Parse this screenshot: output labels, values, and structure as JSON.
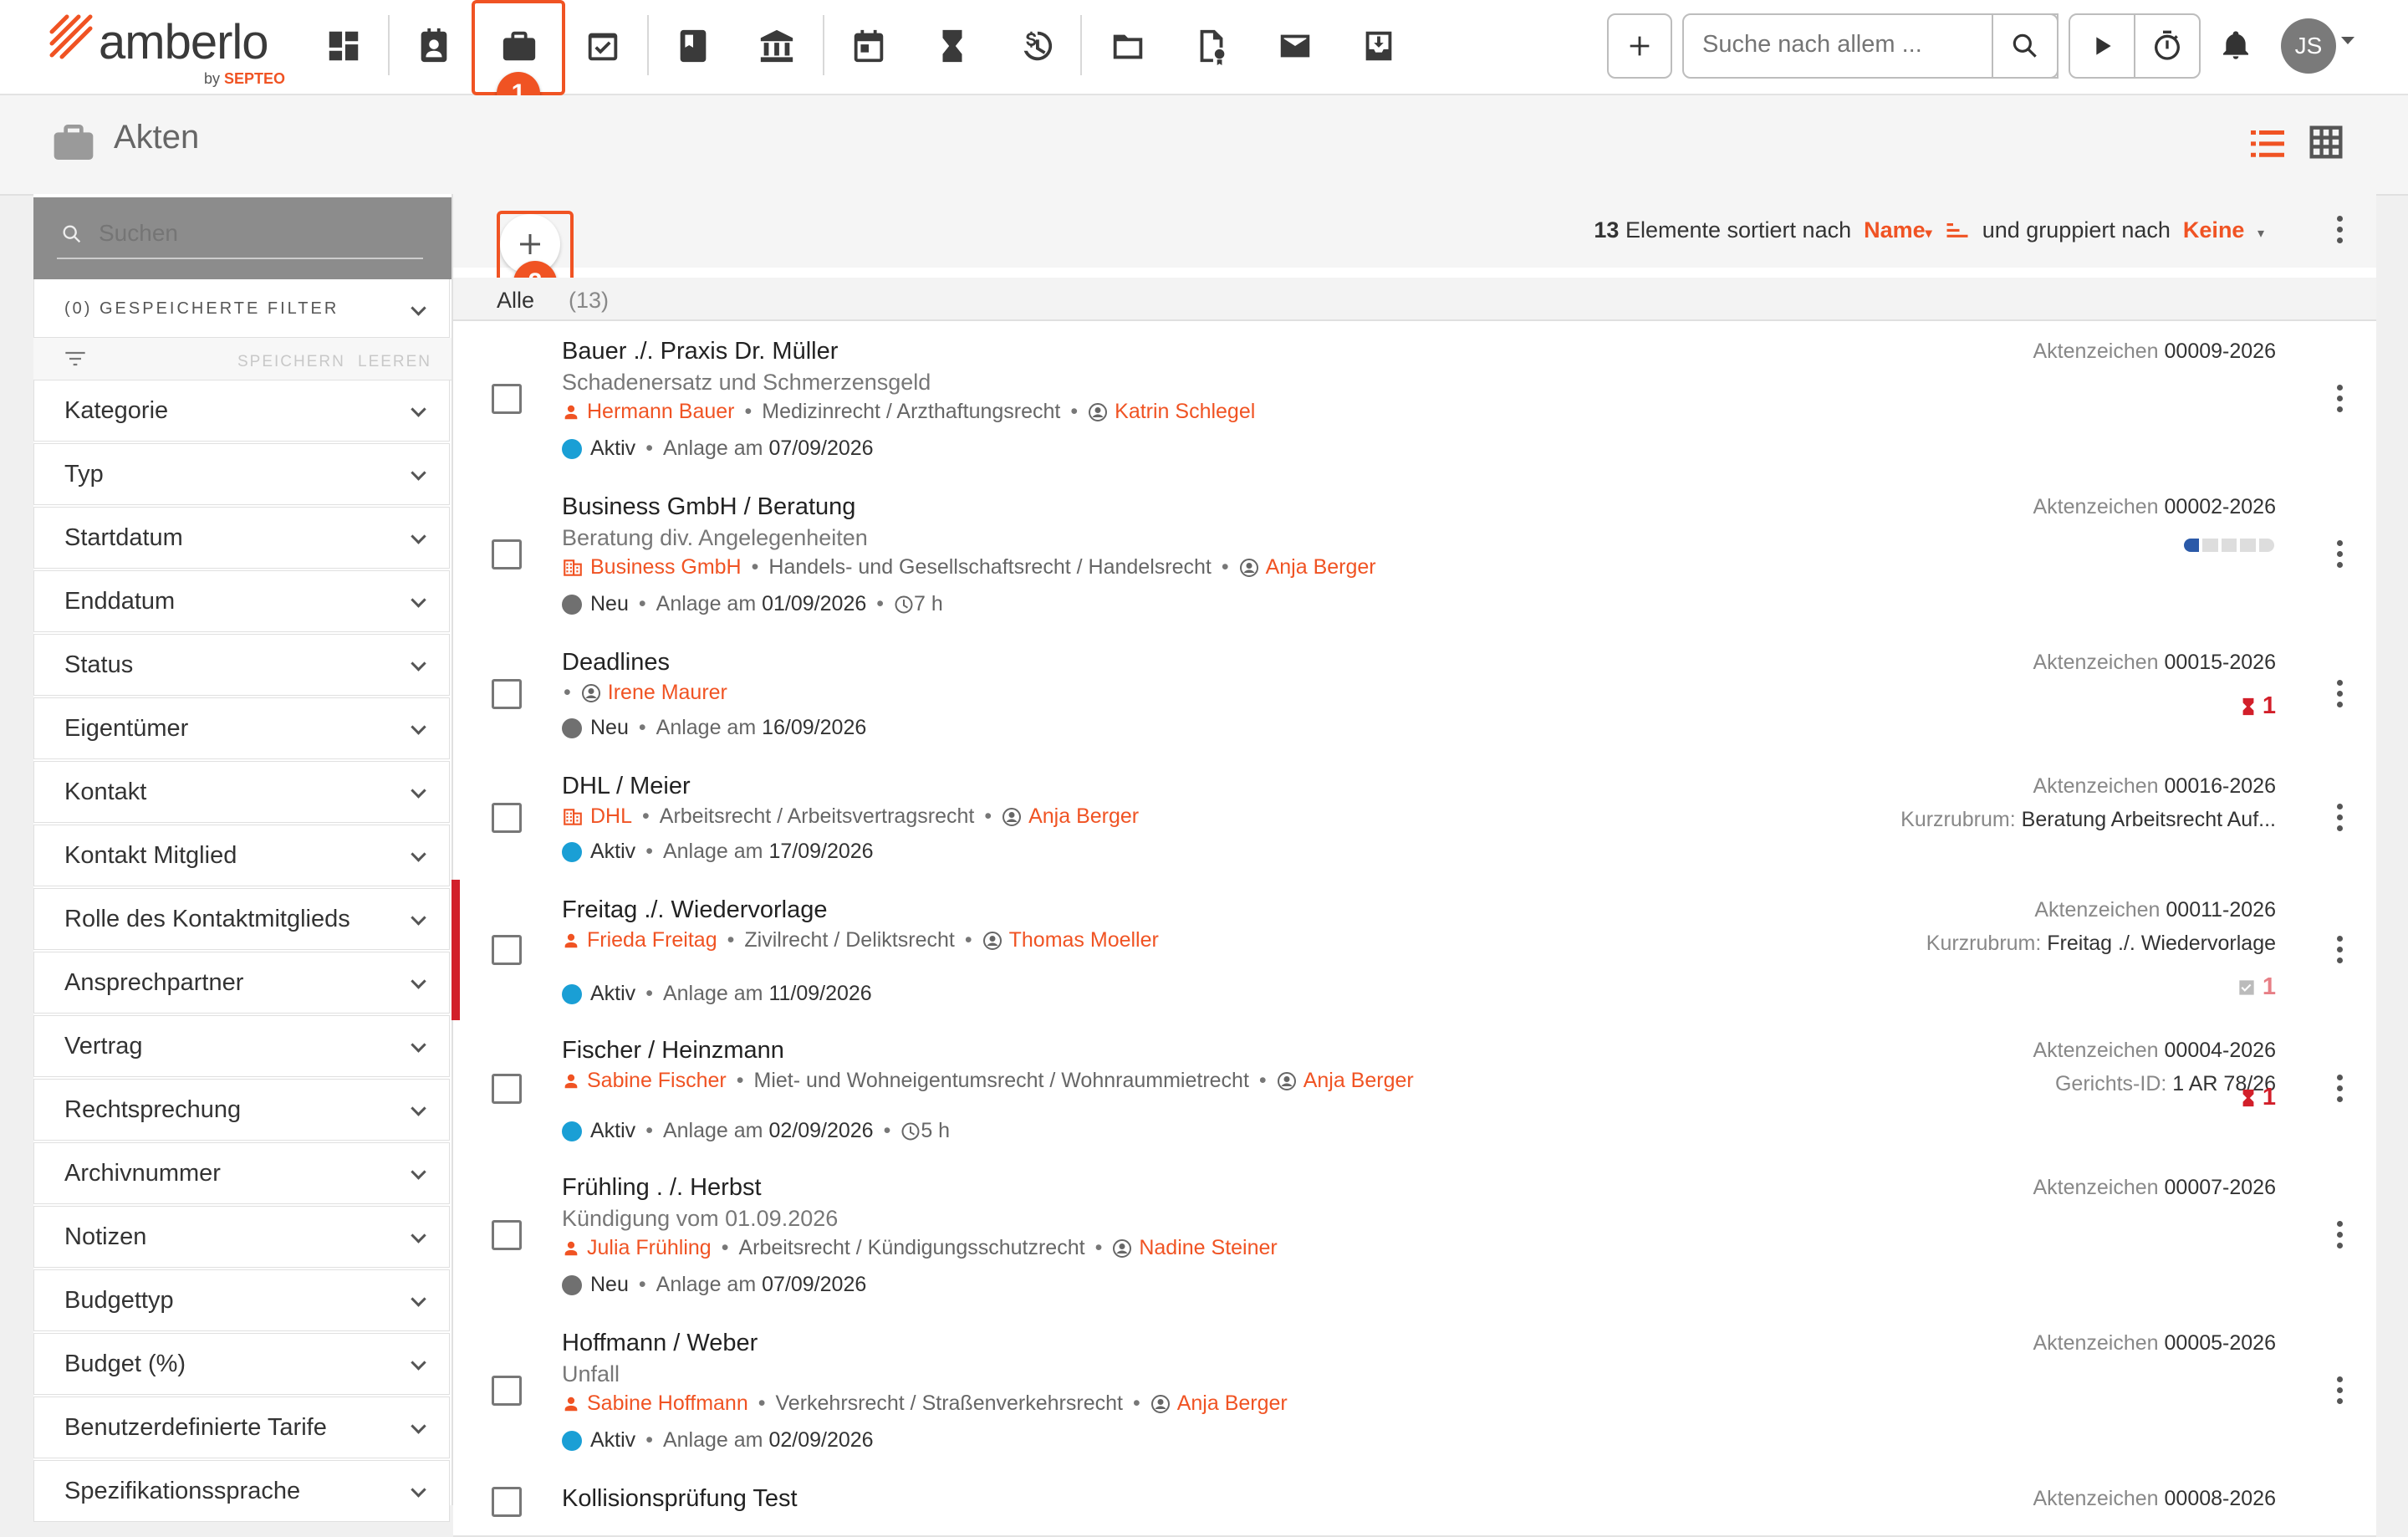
{
  "brand": {
    "name": "amberlo",
    "by": "by",
    "by_company": "SEPTEO"
  },
  "topnav": {
    "icons": [
      "dashboard-icon",
      "contacts-icon",
      "matters-icon",
      "tasks-icon",
      "book-icon",
      "bank-icon",
      "calendar-icon",
      "hourglass-icon",
      "billing-icon",
      "folder-icon",
      "certificate-icon",
      "mail-icon",
      "inbox-icon"
    ],
    "active": "matters-icon",
    "search_placeholder": "Suche nach allem ...",
    "user_initials": "JS"
  },
  "callouts": {
    "step1": "1",
    "step2": "2"
  },
  "page": {
    "title": "Akten"
  },
  "sidebar": {
    "search_placeholder": "Suchen",
    "saved_filters": "(0) GESPEICHERTE FILTER",
    "save": "SPEICHERN",
    "clear": "LEEREN",
    "facets": [
      "Kategorie",
      "Typ",
      "Startdatum",
      "Enddatum",
      "Status",
      "Eigentümer",
      "Kontakt",
      "Kontakt Mitglied",
      "Rolle des Kontaktmitglieds",
      "Ansprechpartner",
      "Vertrag",
      "Rechtsprechung",
      "Archivnummer",
      "Notizen",
      "Budgettyp",
      "Budget (%)",
      "Benutzerdefinierte Tarife",
      "Spezifikationssprache"
    ]
  },
  "list": {
    "count": "13",
    "sorted_by_label": "Elemente sortiert nach",
    "sort_field": "Name",
    "grouped_by_label": "und gruppiert nach",
    "group_field": "Keine",
    "group_name": "Alle",
    "group_count": "(13)",
    "ref_label": "Aktenzeichen",
    "created_label": "Anlage am",
    "short_label": "Kurzrubrum:",
    "court_label": "Gerichts-ID:",
    "rows": [
      {
        "title": "Bauer ./. Praxis Dr. Müller",
        "subtitle": "Schadenersatz und Schmerzensgeld",
        "client": "Hermann Bauer",
        "area": "Medizinrecht / Arzthaftungsrecht",
        "owner": "Katrin Schlegel",
        "status": "Aktiv",
        "status_color": "#1a9fd5",
        "created": "07/09/2026",
        "ref": "00009-2026"
      },
      {
        "title": "Business GmbH / Beratung",
        "subtitle": "Beratung div. Angelegenheiten",
        "client": "Business GmbH",
        "area": "Handels- und Gesellschaftsrecht / Handelsrecht",
        "owner": "Anja Berger",
        "status": "Neu",
        "status_color": "#707070",
        "created": "01/09/2026",
        "time": "7 h",
        "ref": "00002-2026",
        "budget_progress": 0.2
      },
      {
        "title": "Deadlines",
        "owner": "Irene Maurer",
        "status": "Neu",
        "status_color": "#707070",
        "created": "16/09/2026",
        "ref": "00015-2026",
        "deadline_count": "1"
      },
      {
        "title": "DHL / Meier",
        "client": "DHL",
        "area": "Arbeitsrecht / Arbeitsvertragsrecht",
        "owner": "Anja Berger",
        "status": "Aktiv",
        "status_color": "#1a9fd5",
        "created": "17/09/2026",
        "ref": "00016-2026",
        "short": "Beratung Arbeitsrecht Auf..."
      },
      {
        "title": "Freitag ./. Wiedervorlage",
        "client": "Frieda Freitag",
        "area": "Zivilrecht / Deliktsrecht",
        "owner": "Thomas Moeller",
        "status": "Aktiv",
        "status_color": "#1a9fd5",
        "created": "11/09/2026",
        "ref": "00011-2026",
        "short": "Freitag ./. Wiedervorlage",
        "task_count": "1"
      },
      {
        "title": "Fischer / Heinzmann",
        "client": "Sabine Fischer",
        "area": "Miet- und Wohneigentumsrecht / Wohnraummietrecht",
        "owner": "Anja Berger",
        "status": "Aktiv",
        "status_color": "#1a9fd5",
        "created": "02/09/2026",
        "time": "5 h",
        "ref": "00004-2026",
        "court": "1 AR 78/26",
        "deadline_count": "1"
      },
      {
        "title": "Frühling . /. Herbst",
        "subtitle": "Kündigung vom 01.09.2026",
        "client": "Julia Frühling",
        "area": "Arbeitsrecht / Kündigungsschutzrecht",
        "owner": "Nadine Steiner",
        "status": "Neu",
        "status_color": "#707070",
        "created": "07/09/2026",
        "ref": "00007-2026"
      },
      {
        "title": "Hoffmann / Weber",
        "subtitle": "Unfall",
        "client": "Sabine Hoffmann",
        "area": "Verkehrsrecht / Straßenverkehrsrecht",
        "owner": "Anja Berger",
        "status": "Aktiv",
        "status_color": "#1a9fd5",
        "created": "02/09/2026",
        "ref": "00005-2026"
      },
      {
        "title": "Kollisionsprüfung Test",
        "ref": "00008-2026"
      }
    ]
  },
  "colors": {
    "accent": "#f05323",
    "active_status": "#1a9fd5",
    "new_status": "#707070",
    "deadline": "#d21f2a"
  }
}
